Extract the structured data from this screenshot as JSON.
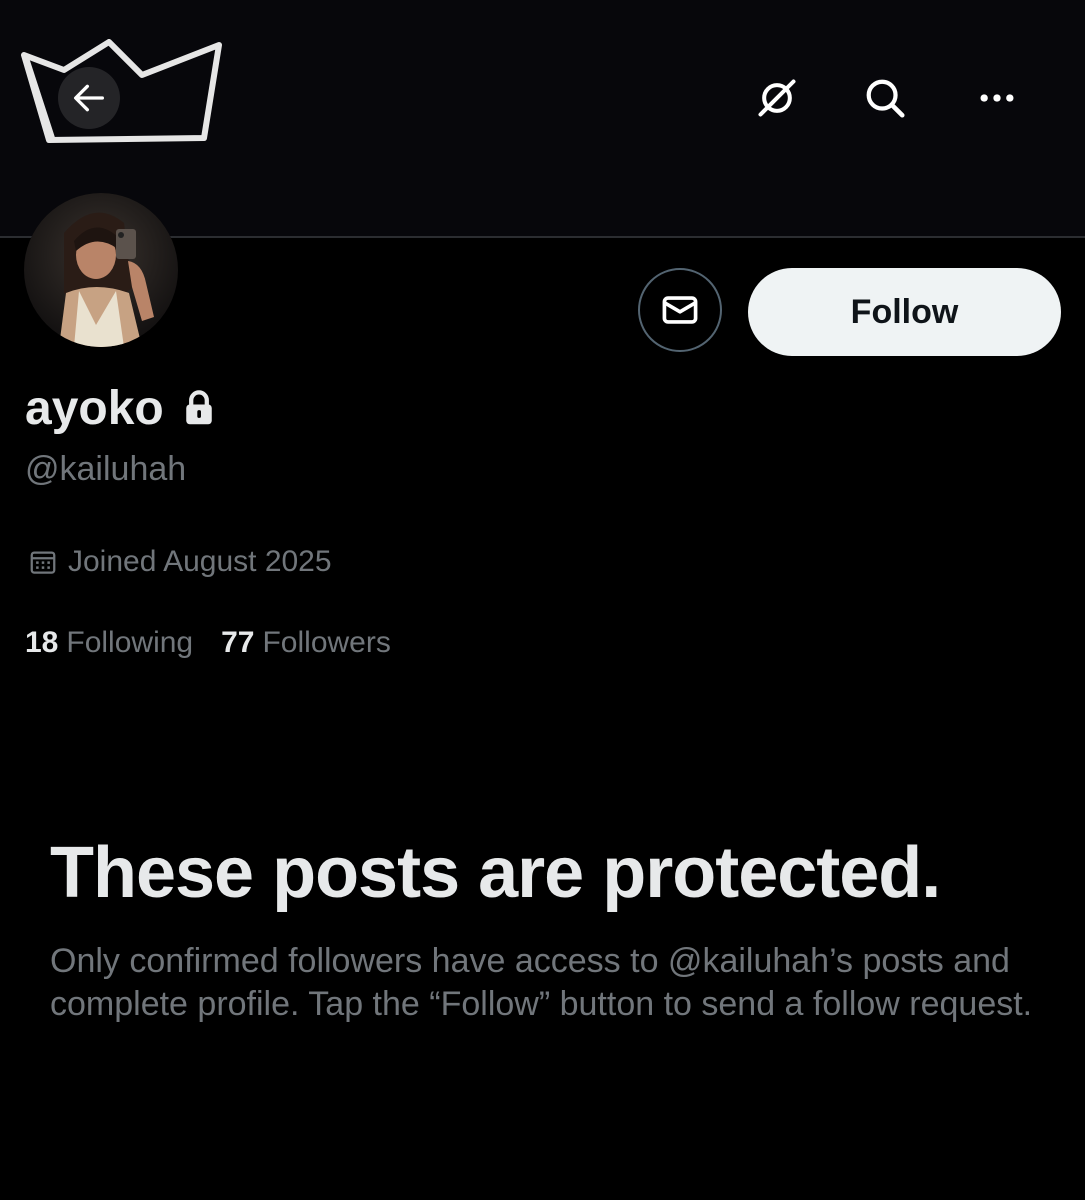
{
  "header": {
    "back_icon": "arrow-left-icon",
    "grok_icon": "grok-icon",
    "search_icon": "search-icon",
    "more_icon": "more-horizontal-icon"
  },
  "profile": {
    "display_name": "ayoko",
    "protected_icon": "lock-icon",
    "handle": "@kailuhah",
    "joined": "Joined August 2025",
    "following_count": "18",
    "following_label": "Following",
    "followers_count": "77",
    "followers_label": "Followers"
  },
  "actions": {
    "message_icon": "mail-icon",
    "follow_label": "Follow"
  },
  "protected": {
    "title": "These posts are protected.",
    "description": "Only confirmed followers have access to @kailuhah’s posts and complete profile. Tap the “Follow” button to send a follow request."
  },
  "colors": {
    "background": "#000000",
    "primary_text": "#e7e9ea",
    "secondary_text": "#71767b",
    "follow_button_bg": "#eff3f4",
    "follow_button_text": "#0f1419"
  }
}
